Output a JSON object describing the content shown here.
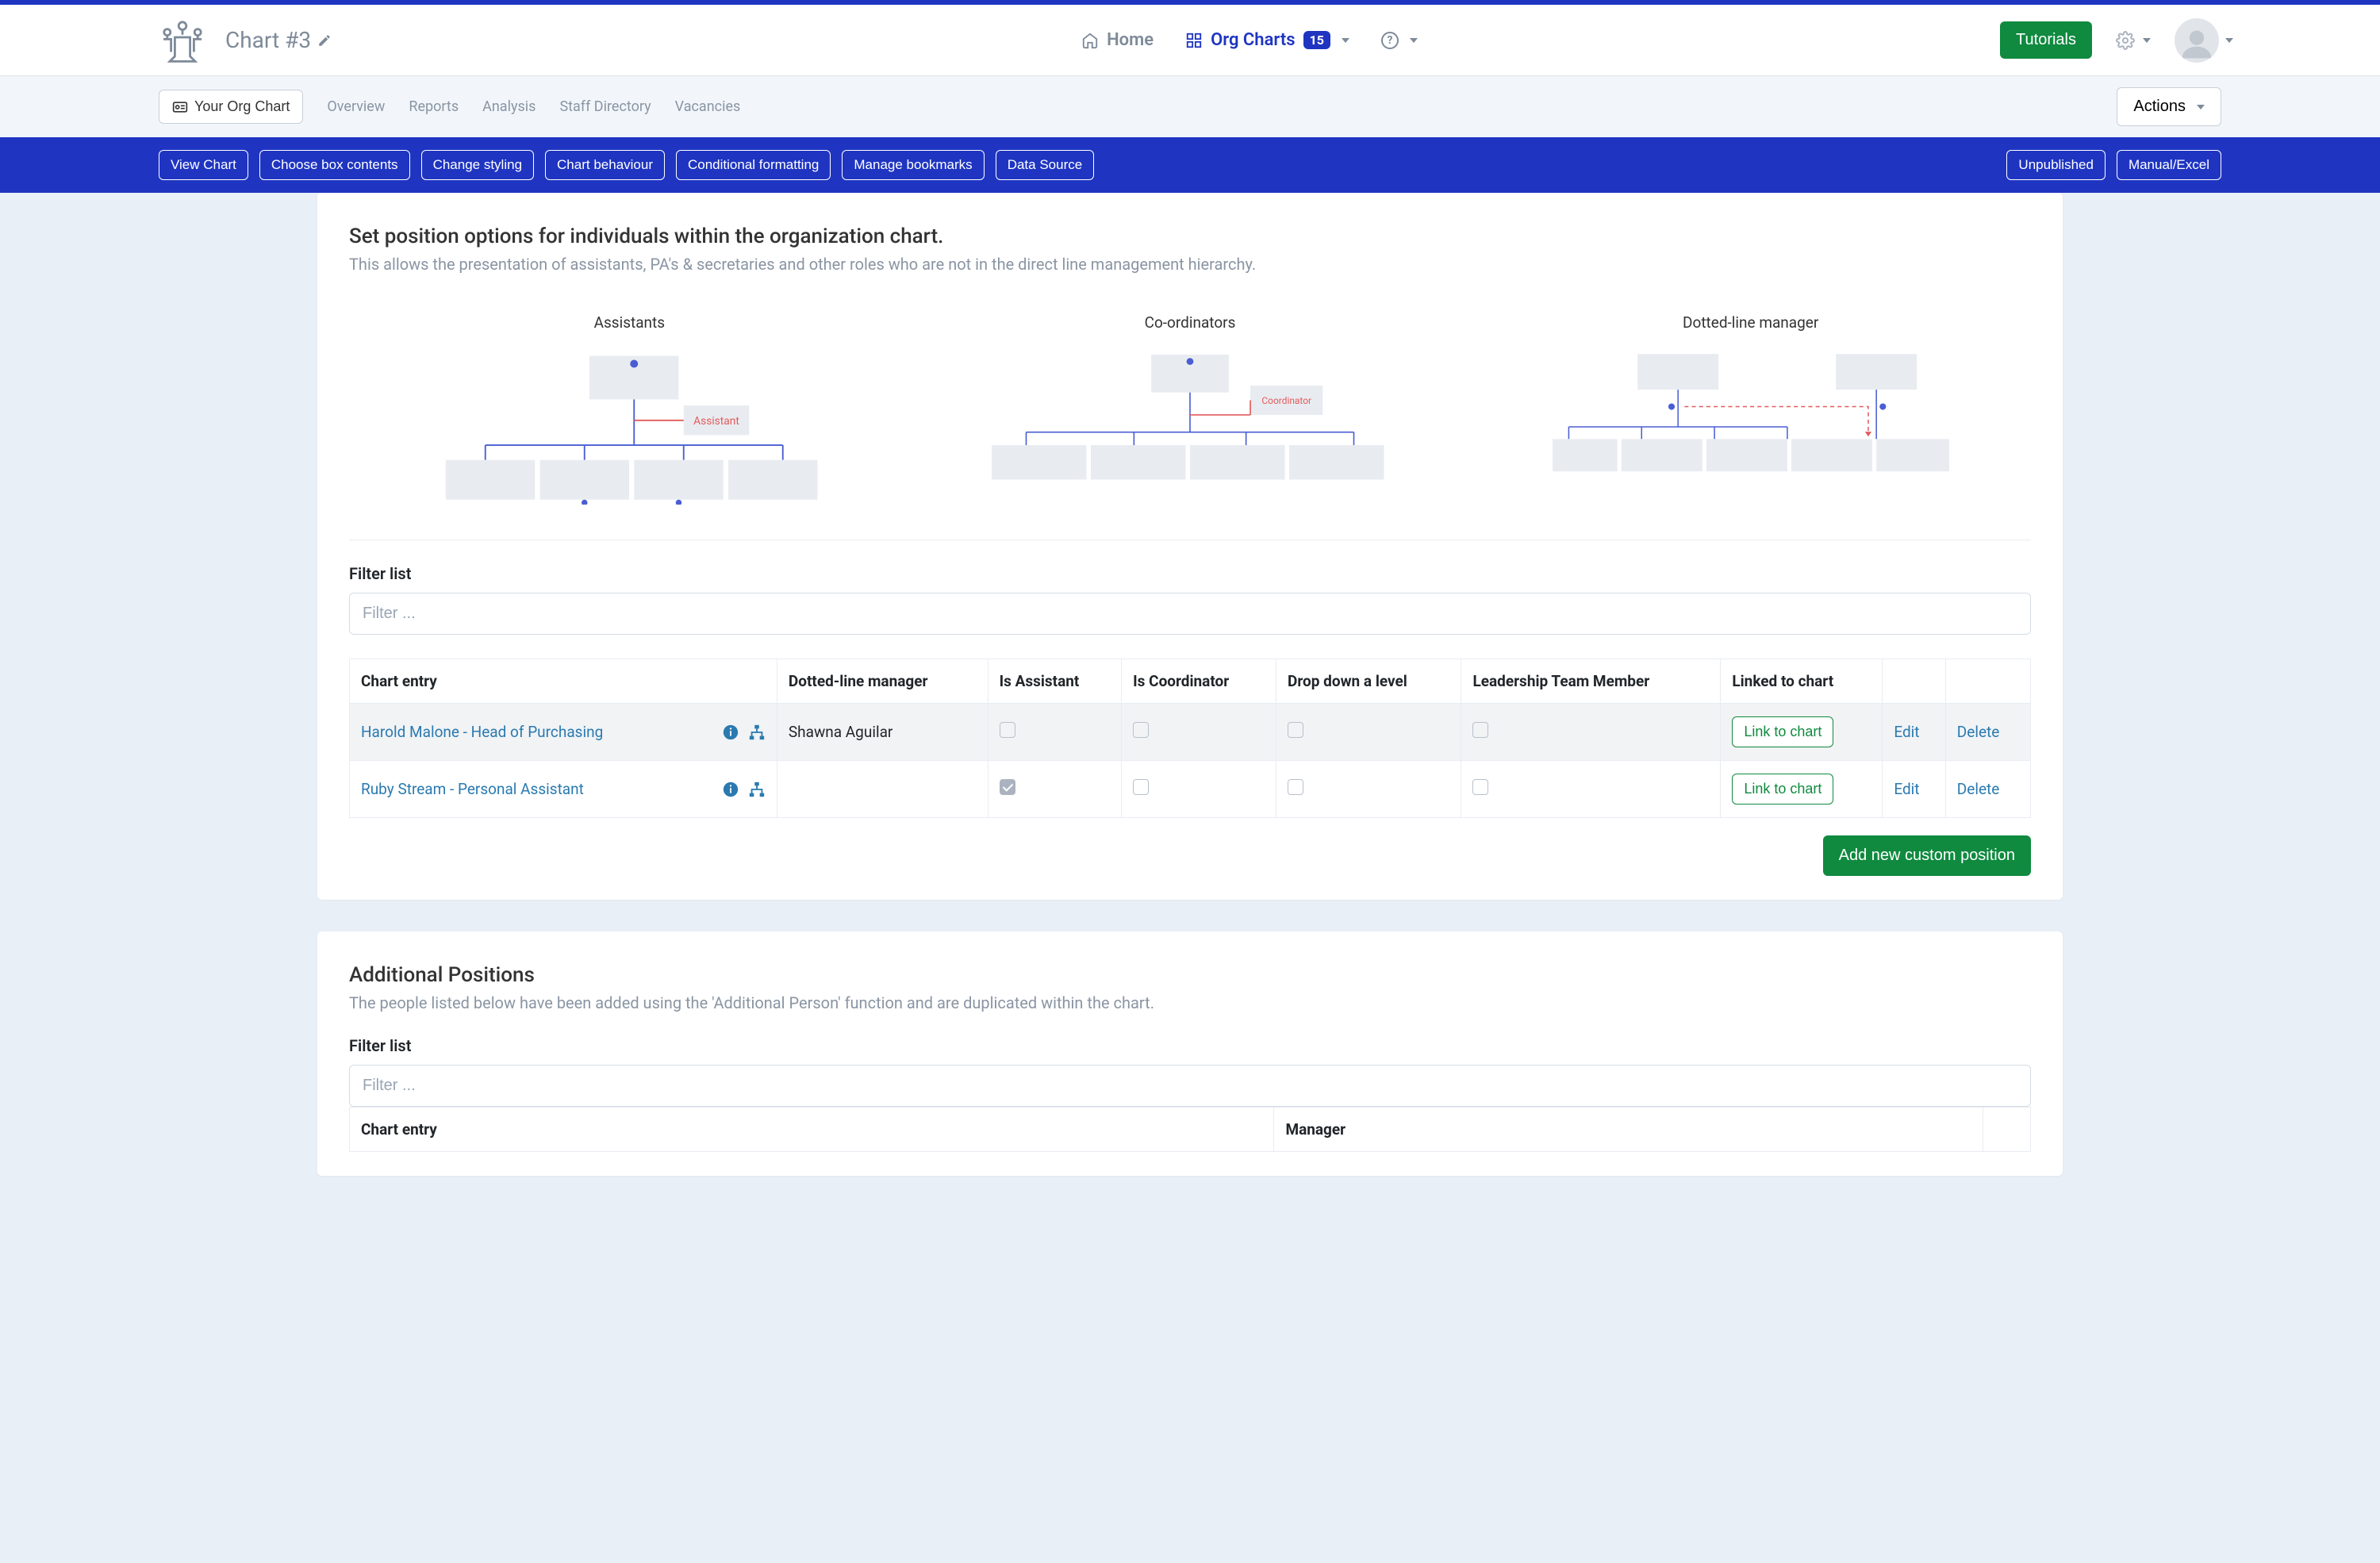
{
  "header": {
    "chart_title": "Chart #3",
    "nav_home": "Home",
    "nav_orgcharts": "Org Charts",
    "orgcharts_count": "15",
    "tutorials": "Tutorials"
  },
  "subheader": {
    "your_org_chart": "Your Org Chart",
    "links": [
      "Overview",
      "Reports",
      "Analysis",
      "Staff Directory",
      "Vacancies"
    ],
    "actions": "Actions"
  },
  "bluebar": {
    "left": [
      "View Chart",
      "Choose box contents",
      "Change styling",
      "Chart behaviour",
      "Conditional formatting",
      "Manage bookmarks",
      "Data Source"
    ],
    "right": [
      "Unpublished",
      "Manual/Excel"
    ]
  },
  "section1": {
    "title": "Set position options for individuals within the organization chart.",
    "subtitle": "This allows the presentation of assistants, PA's & secretaries and other roles who are not in the direct line management hierarchy.",
    "dlabels": [
      "Assistants",
      "Co-ordinators",
      "Dotted-line manager"
    ],
    "dtags": {
      "assistant": "Assistant",
      "coordinator": "Coordinator"
    },
    "filter_label": "Filter list",
    "filter_placeholder": "Filter ...",
    "cols": [
      "Chart entry",
      "Dotted-line manager",
      "Is Assistant",
      "Is Coordinator",
      "Drop down a level",
      "Leadership Team Member",
      "Linked to chart",
      "",
      ""
    ],
    "rows": [
      {
        "entry": "Harold Malone - Head of Purchasing",
        "dotted": "Shawna Aguilar",
        "assistant": false,
        "coordinator": false,
        "drop": false,
        "lead": false
      },
      {
        "entry": "Ruby Stream - Personal Assistant",
        "dotted": "",
        "assistant": true,
        "coordinator": false,
        "drop": false,
        "lead": false
      }
    ],
    "link_to_chart": "Link to chart",
    "edit": "Edit",
    "delete": "Delete",
    "add_button": "Add new custom position"
  },
  "section2": {
    "title": "Additional Positions",
    "subtitle": "The people listed below have been added using the 'Additional Person' function and are duplicated within the chart.",
    "filter_label": "Filter list",
    "filter_placeholder": "Filter ...",
    "cols": [
      "Chart entry",
      "Manager",
      ""
    ]
  }
}
